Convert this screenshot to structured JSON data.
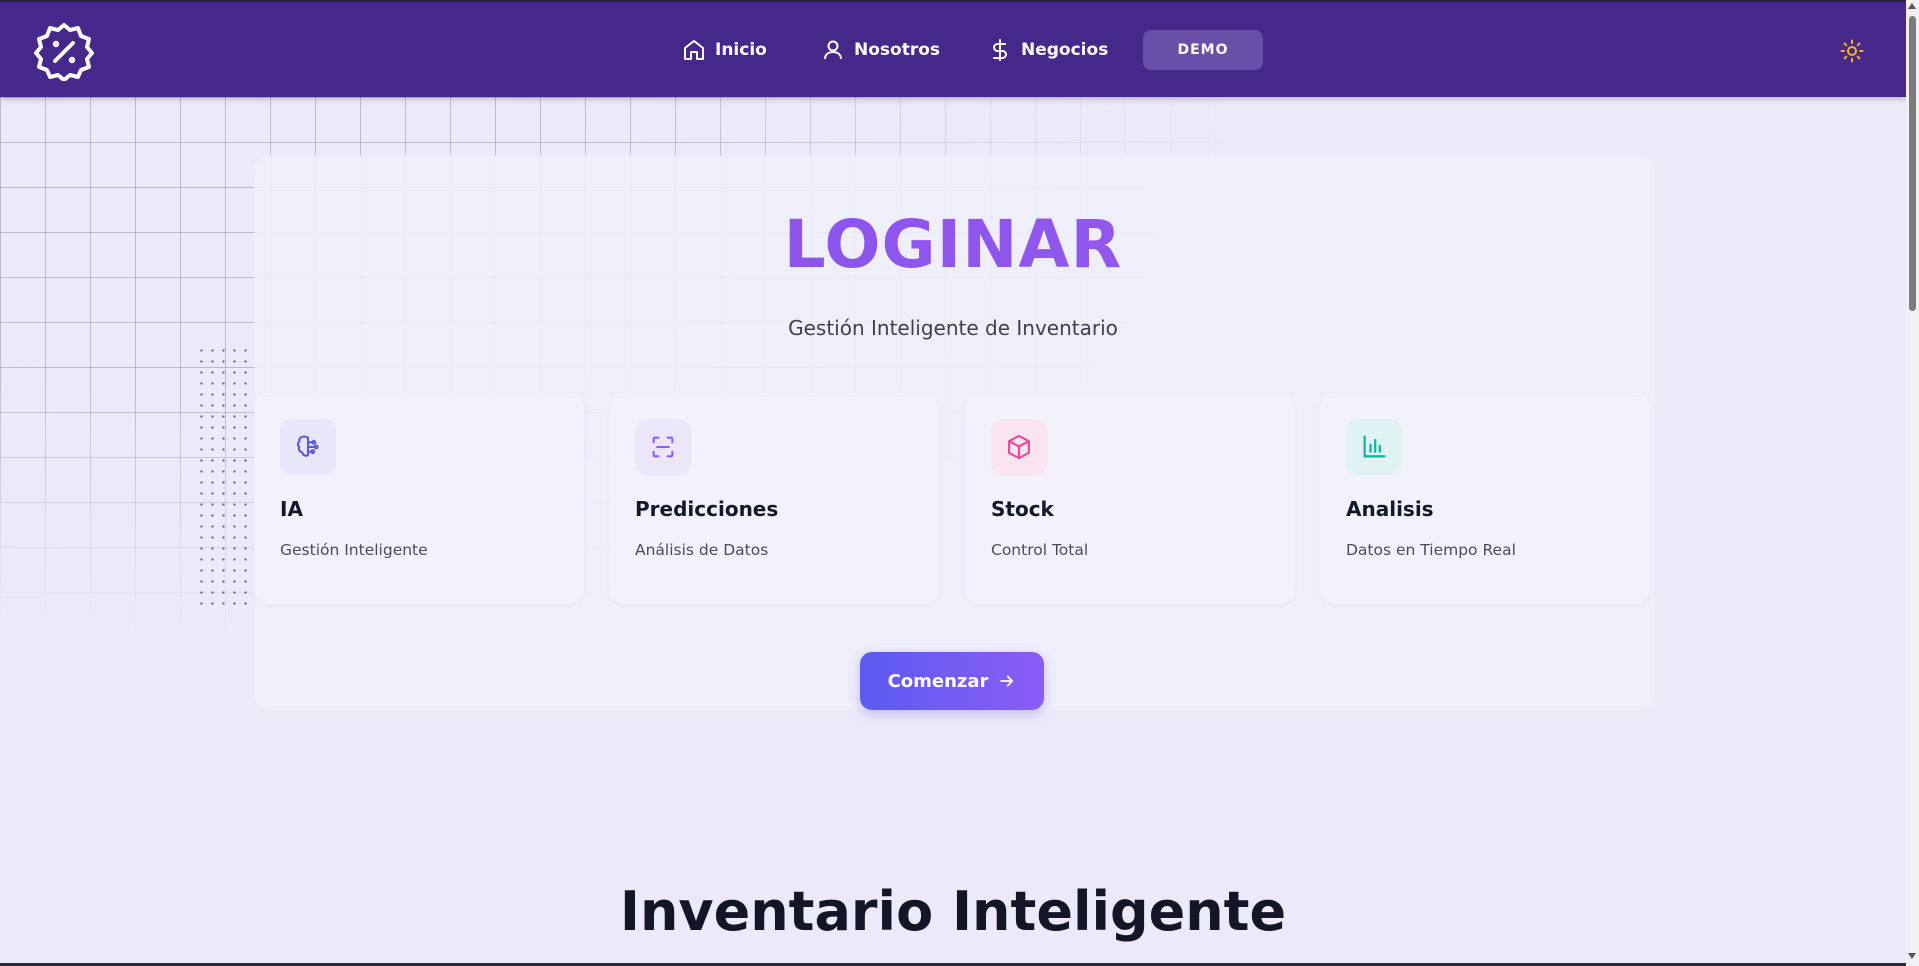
{
  "nav": {
    "items": [
      {
        "label": "Inicio",
        "icon": "home-icon"
      },
      {
        "label": "Nosotros",
        "icon": "user-icon"
      },
      {
        "label": "Negocios",
        "icon": "dollar-icon"
      }
    ],
    "demo_label": "DEMO",
    "logo_icon": "percent-badge-icon",
    "theme_icon": "sun-icon"
  },
  "hero": {
    "title": "LOGINAR",
    "subtitle": "Gestión Inteligente de Inventario",
    "cta_label": "Comenzar"
  },
  "features": [
    {
      "title": "IA",
      "description": "Gestión Inteligente",
      "icon": "brain-icon",
      "icon_color": "#5b5bd6"
    },
    {
      "title": "Predicciones",
      "description": "Análisis de Datos",
      "icon": "scan-icon",
      "icon_color": "#8b5cf6"
    },
    {
      "title": "Stock",
      "description": "Control Total",
      "icon": "box-icon",
      "icon_color": "#ec4899"
    },
    {
      "title": "Analisis",
      "description": "Datos en Tiempo Real",
      "icon": "bar-chart-icon",
      "icon_color": "#14b8a6"
    }
  ],
  "section": {
    "title": "Inventario Inteligente"
  },
  "colors": {
    "navbar": "#46288b",
    "accent": "#8b5cf6",
    "background": "#eceaf8"
  }
}
